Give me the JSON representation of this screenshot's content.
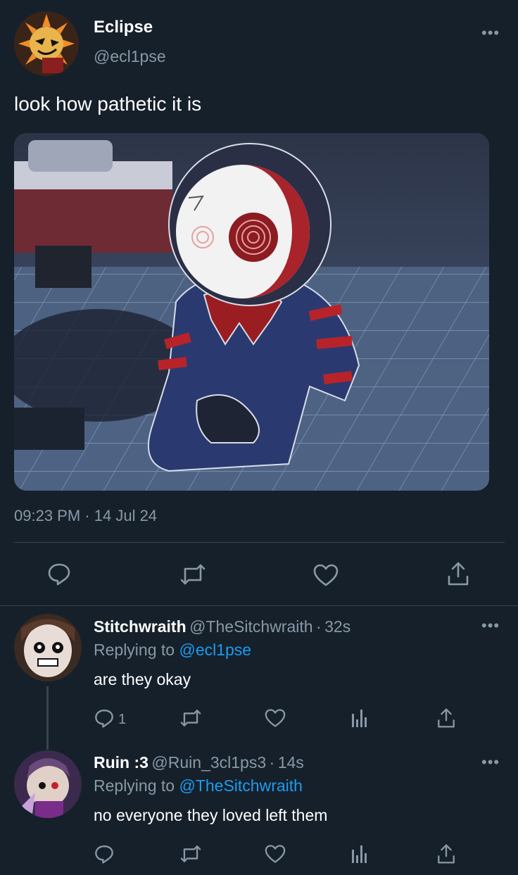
{
  "tweet": {
    "author_name": "Eclipse",
    "author_handle": "@ecl1pse",
    "text": "look how pathetic it is",
    "time": "09:23 PM",
    "date": "14 Jul 24",
    "dot": "·",
    "more": "•••"
  },
  "replies": [
    {
      "name": "Stitchwraith",
      "handle": "@TheSitchwraith",
      "time": "32s",
      "replying_label": "Replying to",
      "replying_to": "@ecl1pse",
      "text": "are they okay",
      "reply_count": "1"
    },
    {
      "name": "Ruin :3",
      "handle": "@Ruin_3cl1ps3",
      "time": "14s",
      "replying_label": "Replying to",
      "replying_to": "@TheSitchwraith",
      "text": "no everyone they loved left them",
      "reply_count": ""
    }
  ],
  "icons": {
    "reply": "reply-icon",
    "retweet": "retweet-icon",
    "like": "heart-icon",
    "share": "share-icon",
    "views": "analytics-icon",
    "more": "more-icon"
  },
  "colors": {
    "background": "#16202b",
    "text": "#ffffff",
    "muted": "#8899a6",
    "link": "#1d9bf0",
    "divider": "#38444d"
  }
}
